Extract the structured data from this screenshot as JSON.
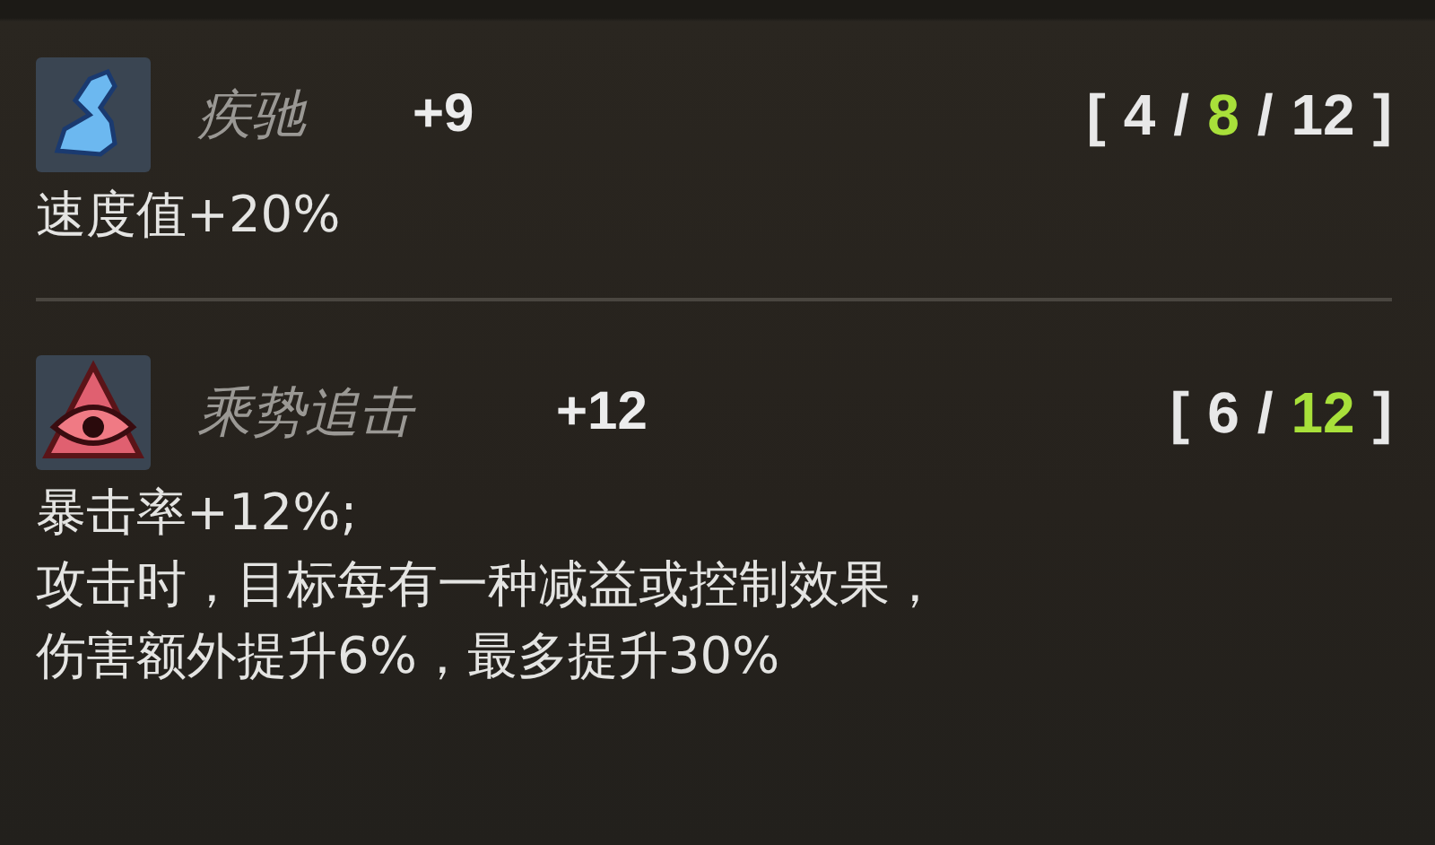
{
  "traits": [
    {
      "kind": "speed",
      "name": "疾驰",
      "bonus": "+9",
      "bracket_open": "[",
      "bracket_close": "]",
      "separator": "/",
      "tiers": [
        {
          "value": "4",
          "selected": false
        },
        {
          "value": "8",
          "selected": true
        },
        {
          "value": "12",
          "selected": false
        }
      ],
      "description": [
        "速度值+20%"
      ]
    },
    {
      "kind": "crit",
      "name": "乘势追击",
      "bonus": "+12",
      "bracket_open": "[",
      "bracket_close": "]",
      "separator": "/",
      "tiers": [
        {
          "value": "6",
          "selected": false
        },
        {
          "value": "12",
          "selected": true
        }
      ],
      "description": [
        "暴击率+12%;",
        "攻击时，目标每有一种减益或控制效果，",
        "伤害额外提升6%，最多提升30%"
      ]
    }
  ]
}
